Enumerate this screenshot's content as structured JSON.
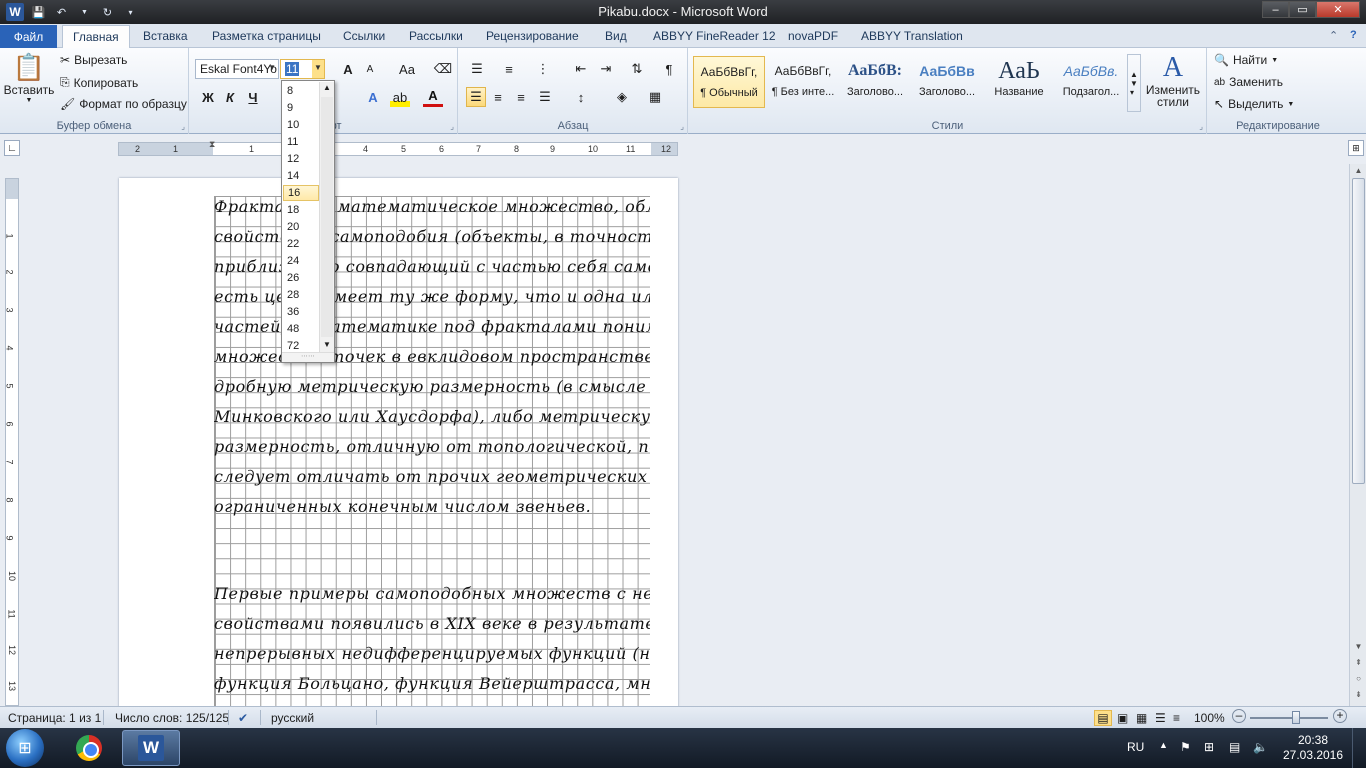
{
  "window": {
    "title": "Pikabu.docx - Microsoft Word",
    "controls": {
      "minimize": "–",
      "maximize": "▭",
      "close": "✕"
    }
  },
  "tabs": {
    "file": "Файл",
    "items": [
      "Главная",
      "Вставка",
      "Разметка страницы",
      "Ссылки",
      "Рассылки",
      "Рецензирование",
      "Вид",
      "ABBYY FineReader 12",
      "novaPDF",
      "ABBYY Translation"
    ]
  },
  "clipboard": {
    "paste": "Вставить",
    "cut": "Вырезать",
    "copy": "Копировать",
    "format_painter": "Формат по образцу",
    "label": "Буфер обмена"
  },
  "font": {
    "family": "Eskal Font4Yo",
    "size": "11",
    "bold": "Ж",
    "italic": "К",
    "underline": "Ч",
    "grow": "A",
    "shrink": "A",
    "case": "Aa",
    "label": "Шрифт"
  },
  "paragraph": {
    "label": "Абзац"
  },
  "styles": {
    "label": "Стили",
    "change": "Изменить стили",
    "items": [
      {
        "sample": "АаБбВвГг,",
        "name": "¶ Обычный"
      },
      {
        "sample": "АаБбВвГг,",
        "name": "¶ Без инте..."
      },
      {
        "sample": "АаБбВ:",
        "name": "Заголово..."
      },
      {
        "sample": "АаБбВв",
        "name": "Заголово..."
      },
      {
        "sample": "АаЬ",
        "name": "Название"
      },
      {
        "sample": "АаБбВв.",
        "name": "Подзагол..."
      }
    ]
  },
  "editing": {
    "label": "Редактирование",
    "find": "Найти",
    "replace": "Заменить",
    "select": "Выделить"
  },
  "font_size_dropdown": {
    "items": [
      "8",
      "9",
      "10",
      "11",
      "12",
      "14",
      "16",
      "18",
      "20",
      "22",
      "24",
      "26",
      "28",
      "36",
      "48",
      "72"
    ],
    "highlighted": "16"
  },
  "ruler": {
    "marks": [
      "2",
      "1",
      "1",
      "2",
      "3",
      "4",
      "5",
      "6",
      "7",
      "8",
      "9",
      "10",
      "11",
      "12"
    ],
    "vmarks": [
      "1",
      "2",
      "3",
      "4",
      "5",
      "6",
      "7",
      "8",
      "9",
      "10",
      "11",
      "12",
      "13"
    ]
  },
  "document": {
    "lines": [
      "Фракталы — математическое множество, обладающее",
      "свойствами самоподобия (объекты, в точности или",
      "приближенно совпадающий с частью себя самого, то",
      "есть целое имеет ту же форму, что и одна или более",
      "частей). В математике под фракталами понимают",
      "множества точек в евклидовом пространстве, имеющие",
      "дробную метрическую размерность (в смысле",
      "Минковского или Хаусдорфа), либо метрическую",
      "размерность, отличную от топологической, поэтому их",
      "следует отличать от прочих геометрических фигур,",
      "ограниченных конечным числом звеньев.",
      "Первые примеры самоподобных множеств с необычными",
      "свойствами появились в XIX веке в результате изучения",
      "непрерывных недифференцируемых функций (например,",
      "функция Больцано, функция Вейерштрасса, множество"
    ]
  },
  "status": {
    "page": "Страница: 1 из 1",
    "words": "Число слов: 125/125",
    "language": "русский",
    "zoom": "100%",
    "zoom_out": "–",
    "zoom_in": "+"
  },
  "taskbar": {
    "lang": "RU",
    "time": "20:38",
    "date": "27.03.2016"
  }
}
